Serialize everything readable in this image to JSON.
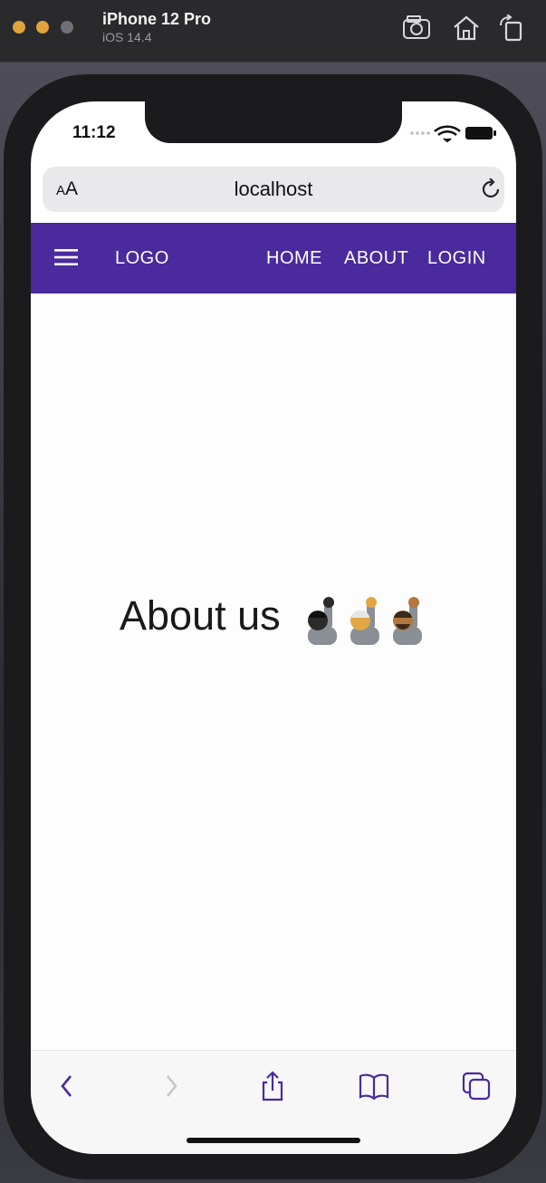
{
  "simulator": {
    "device_name": "iPhone 12 Pro",
    "os_version": "iOS 14.4",
    "tools": [
      "camera-icon",
      "home-icon",
      "rotate-icon"
    ]
  },
  "status_bar": {
    "time": "11:12"
  },
  "address_bar": {
    "text_size_small": "A",
    "text_size_large": "A",
    "url": "localhost"
  },
  "navbar": {
    "background": "#4a2a9c",
    "logo": "LOGO",
    "links": [
      "HOME",
      "ABOUT",
      "LOGIN"
    ]
  },
  "main": {
    "heading": "About us",
    "emoji_count": 3
  },
  "safari_toolbar": {
    "icons": [
      "back-icon",
      "forward-icon",
      "share-icon",
      "bookmarks-icon",
      "tabs-icon"
    ],
    "accent": "#4a2a9c"
  }
}
